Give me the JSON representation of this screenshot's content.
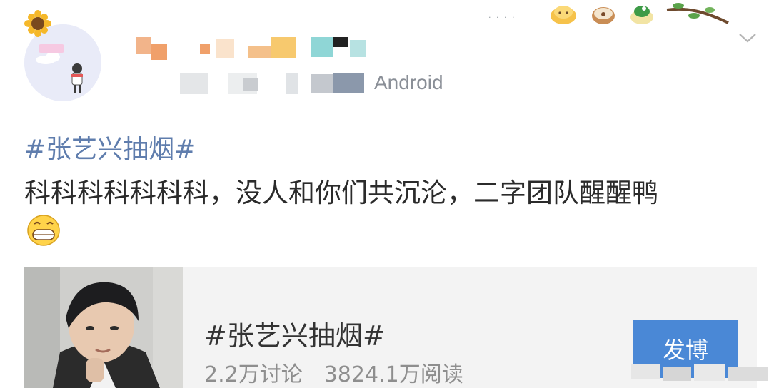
{
  "post": {
    "source_suffix": "Android",
    "hashtag": "#张艺兴抽烟#",
    "text": "科科科科科科科，没人和你们共沉沦，二字团队醒醒鸭"
  },
  "topic_card": {
    "title": "#张艺兴抽烟#",
    "discussions": "2.2万讨论",
    "reads": "3824.1万阅读",
    "post_button": "发博"
  },
  "colors": {
    "hashtag": "#5f7dad",
    "button": "#4a88d6",
    "muted": "#8e8e8e"
  },
  "icons": [
    "sunflower-icon",
    "bun-sticker-icon",
    "donut-sticker-icon",
    "cupcake-sticker-icon",
    "branch-sticker-icon",
    "chevron-down-icon",
    "grin-emoji-icon"
  ]
}
